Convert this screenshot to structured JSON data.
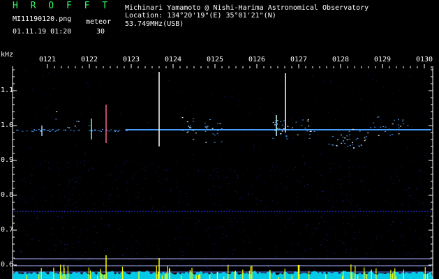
{
  "header": {
    "brand": "H R O F F T",
    "file": "MI11190120.png",
    "meteor_label": "meteor",
    "datetime": "01.11.19 01:20",
    "meteor_count": "30",
    "author": "Michinari Yamamoto @ Nishi-Harima Astronomical Observatory",
    "location": "Location: 134°20'19\"(E) 35°01'21\"(N)",
    "frequency": "53.749MHz(USB)"
  },
  "axes": {
    "unit": "kHz",
    "y_ticks": [
      "1.1",
      "1.0",
      "0.9",
      "0.8",
      "0.7",
      "0.6"
    ],
    "x_ticks": [
      "0121",
      "0122",
      "0123",
      "0124",
      "0125",
      "0126",
      "0127",
      "0128",
      "0129",
      "0130"
    ]
  },
  "colors": {
    "background": "#000000",
    "text": "#ffffff",
    "brand": "#33ff66",
    "carrier": "#4aa0ff",
    "meteor": "#ffffff",
    "noise": "#1a2a90",
    "baseline": "#00e0ff",
    "burst": "#ffff00"
  }
}
